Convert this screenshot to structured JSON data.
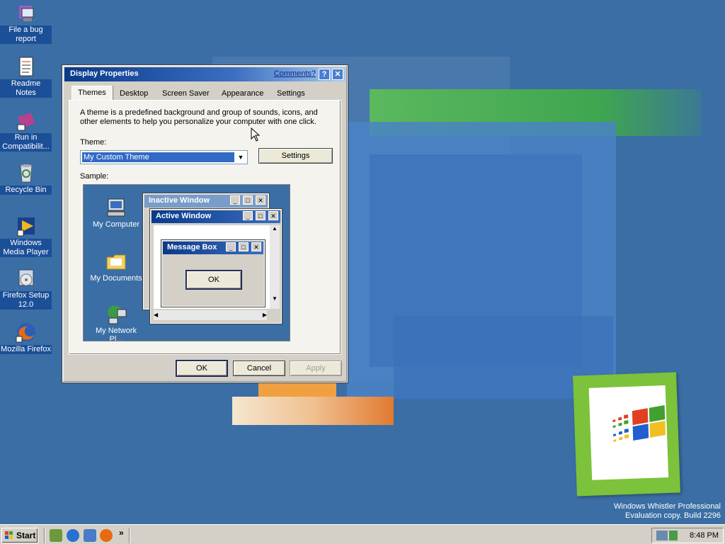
{
  "desktop": {
    "icons": [
      {
        "label": "File a bug report",
        "icon": "bug-report-icon"
      },
      {
        "label": "Readme Notes",
        "icon": "notes-icon"
      },
      {
        "label": "Run in Compatibilit...",
        "icon": "compatibility-icon"
      },
      {
        "label": "Recycle Bin",
        "icon": "recycle-bin-icon"
      },
      {
        "label": "Windows Media Player",
        "icon": "media-player-icon"
      },
      {
        "label": "Firefox Setup 12.0",
        "icon": "installer-icon"
      },
      {
        "label": "Mozilla Firefox",
        "icon": "firefox-icon"
      }
    ],
    "watermark_line1": "Windows Whistler Professional",
    "watermark_line2": "Evaluation copy. Build 2296"
  },
  "dialog": {
    "title": "Display Properties",
    "comments_link": "Comments?",
    "help_label": "?",
    "close_label": "✕",
    "tabs": [
      {
        "label": "Themes"
      },
      {
        "label": "Desktop"
      },
      {
        "label": "Screen Saver"
      },
      {
        "label": "Appearance"
      },
      {
        "label": "Settings"
      }
    ],
    "description": "A theme is a predefined background and group of sounds, icons, and other elements to help you personalize your computer with one click.",
    "theme_label": "Theme:",
    "theme_value": "My Custom Theme",
    "settings_button": "Settings",
    "sample_label": "Sample:",
    "sample": {
      "icons": [
        {
          "label": "My Computer"
        },
        {
          "label": "My Documents"
        },
        {
          "label": "My Network Pl..."
        }
      ],
      "inactive_title": "Inactive Window",
      "active_title": "Active Window",
      "message_title": "Message Box",
      "ok_label": "OK"
    },
    "ok_button": "OK",
    "cancel_button": "Cancel",
    "apply_button": "Apply"
  },
  "taskbar": {
    "start_label": "Start",
    "chevron": "»",
    "clock": "8:48 PM"
  },
  "colors": {
    "desktop": "#3a6ea5",
    "active_title": "#0a3a8a",
    "inactive_title": "#7a9cc8",
    "selection": "#316ac5"
  }
}
